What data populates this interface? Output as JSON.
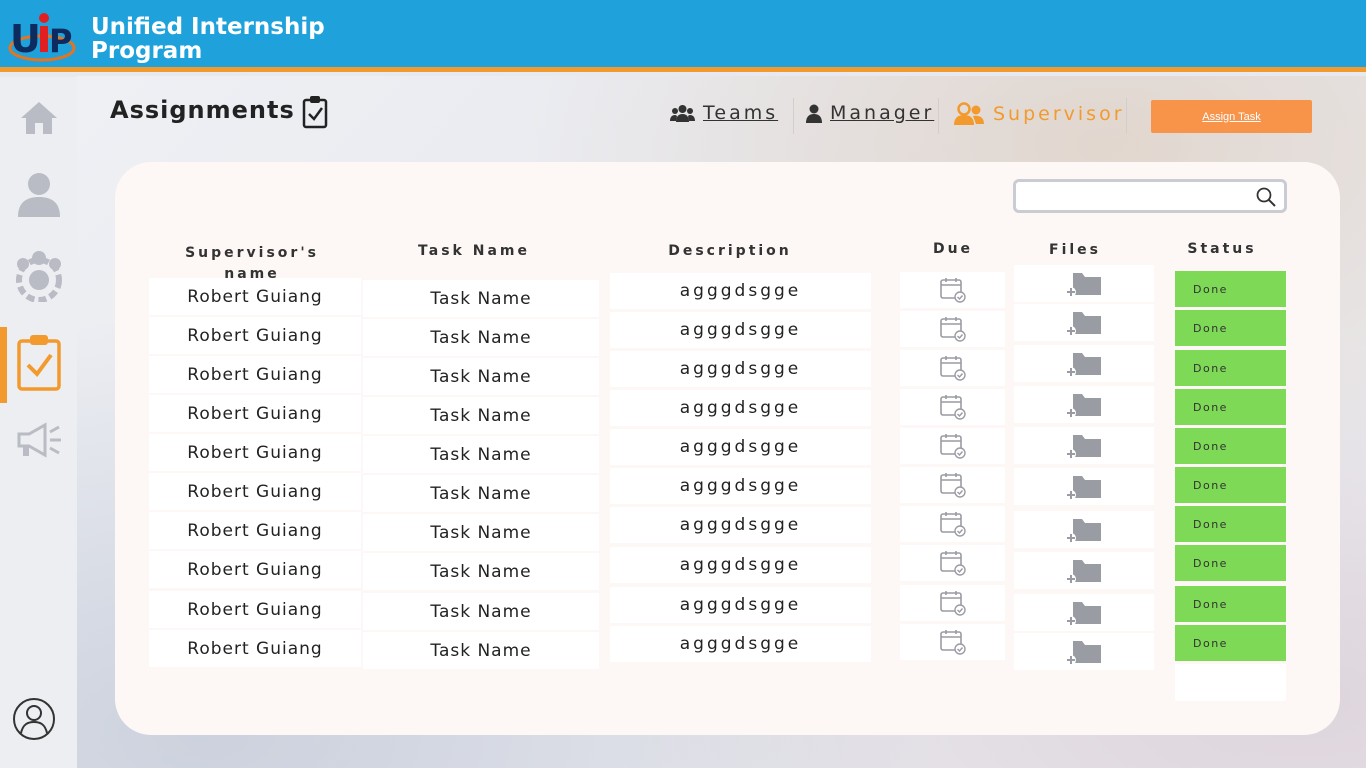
{
  "app": {
    "title": "Unified Internship Program",
    "brand_color": "#1fa2dc",
    "accent_color": "#f29a2e"
  },
  "sidebar": {
    "items": [
      {
        "icon": "home-icon",
        "active": false
      },
      {
        "icon": "user-icon",
        "active": false
      },
      {
        "icon": "team-gear-icon",
        "active": false
      },
      {
        "icon": "clipboard-check-icon",
        "active": true
      },
      {
        "icon": "megaphone-icon",
        "active": false
      }
    ],
    "footer_icon": "account-icon"
  },
  "page": {
    "title": "Assignments",
    "title_icon": "clipboard-check-icon"
  },
  "tabs": [
    {
      "label": "Teams",
      "icon": "users-icon",
      "active": false
    },
    {
      "label": "Manager",
      "icon": "user-icon",
      "active": false
    },
    {
      "label": "Supervisor",
      "icon": "user-group-icon",
      "active": true
    }
  ],
  "assign_button": {
    "label": "Assign Task"
  },
  "search": {
    "value": "",
    "placeholder": ""
  },
  "table": {
    "headers": [
      "Supervisor's name",
      "Task Name",
      "Description",
      "Due",
      "Files",
      "Status"
    ],
    "rows": [
      {
        "name": "Robert Guiang",
        "task": "Task Name",
        "description": "agggdsgge",
        "status": "Done"
      },
      {
        "name": "Robert Guiang",
        "task": "Task Name",
        "description": "agggdsgge",
        "status": "Done"
      },
      {
        "name": "Robert Guiang",
        "task": "Task Name",
        "description": "agggdsgge",
        "status": "Done"
      },
      {
        "name": "Robert Guiang",
        "task": "Task Name",
        "description": "agggdsgge",
        "status": "Done"
      },
      {
        "name": "Robert Guiang",
        "task": "Task Name",
        "description": "agggdsgge",
        "status": "Done"
      },
      {
        "name": "Robert Guiang",
        "task": "Task Name",
        "description": "agggdsgge",
        "status": "Done"
      },
      {
        "name": "Robert Guiang",
        "task": "Task Name",
        "description": "agggdsgge",
        "status": "Done"
      },
      {
        "name": "Robert Guiang",
        "task": "Task Name",
        "description": "agggdsgge",
        "status": "Done"
      },
      {
        "name": "Robert Guiang",
        "task": "Task Name",
        "description": "agggdsgge",
        "status": "Done"
      },
      {
        "name": "Robert Guiang",
        "task": "Task Name",
        "description": "agggdsgge",
        "status": "Done"
      }
    ],
    "status_color": "#7ed957"
  }
}
